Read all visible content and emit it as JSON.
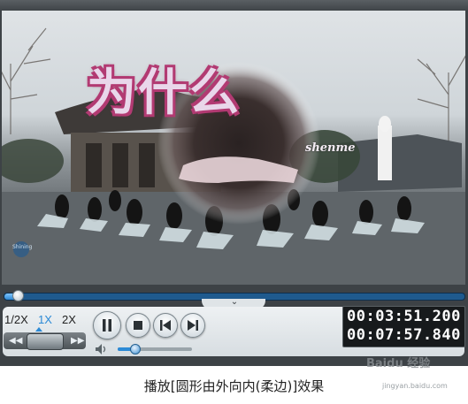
{
  "video": {
    "overlay_text": "为什么",
    "overlay_subtext": "shenme",
    "logo_text": "Shining"
  },
  "playback": {
    "progress_fraction": 0.03,
    "volume_fraction": 0.25
  },
  "speed": {
    "options": [
      "1/2X",
      "1X",
      "2X"
    ],
    "selected": "1X"
  },
  "time": {
    "current": "00:03:51.200",
    "total": "00:07:57.840"
  },
  "caption": "播放[圆形由外向内(柔边)]效果",
  "watermark": {
    "text": "Baidu 经验",
    "url": "jingyan.baidu.com"
  },
  "colors": {
    "accent": "#2c8ad6",
    "overlay_outline": "#b23a72",
    "panel_bg": "#3d4246"
  }
}
